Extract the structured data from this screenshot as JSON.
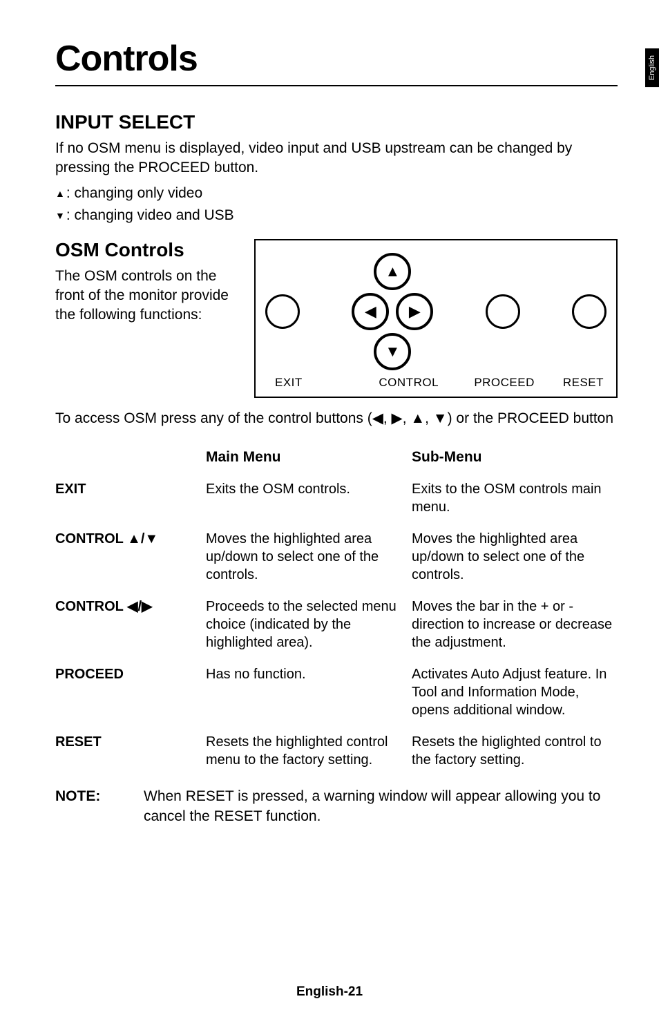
{
  "side_tab": "English",
  "title": "Controls",
  "input_select": {
    "heading": "INPUT SELECT",
    "para": "If no OSM menu is displayed, video input and USB upstream can be changed by pressing the PROCEED button.",
    "line_up": ": changing only video",
    "line_down": ": changing video and USB"
  },
  "osm_controls": {
    "heading": "OSM Controls",
    "para": "The OSM controls on the front of the monitor provide the following functions:",
    "diagram_labels": {
      "exit": "EXIT",
      "control": "CONTROL",
      "proceed": "PROCEED",
      "reset": "RESET"
    },
    "access_pre": "To access OSM press any of the control buttons (",
    "access_post": ") or the PROCEED button"
  },
  "table": {
    "header_main": "Main Menu",
    "header_sub": "Sub-Menu",
    "rows": [
      {
        "label": "EXIT",
        "main": "Exits the OSM controls.",
        "sub": "Exits to the OSM controls main menu."
      },
      {
        "label": "CONTROL ▲/▼",
        "main": "Moves the highlighted area up/down to select one of the controls.",
        "sub": "Moves the highlighted area up/down to select one of the controls."
      },
      {
        "label": "CONTROL ◀/▶",
        "main": "Proceeds to the selected menu choice (indicated by the highlighted area).",
        "sub": "Moves the bar in the + or - direction to increase or decrease the adjustment."
      },
      {
        "label": "PROCEED",
        "main": "Has no function.",
        "sub": "Activates Auto Adjust feature. In Tool and Information Mode, opens additional window."
      },
      {
        "label": "RESET",
        "main": "Resets the highlighted control menu to the factory setting.",
        "sub": "Resets the higlighted control to the factory setting."
      }
    ]
  },
  "note": {
    "label": "NOTE:",
    "text": "When RESET is pressed, a warning window will appear allowing you to cancel the RESET function."
  },
  "footer": "English-21"
}
